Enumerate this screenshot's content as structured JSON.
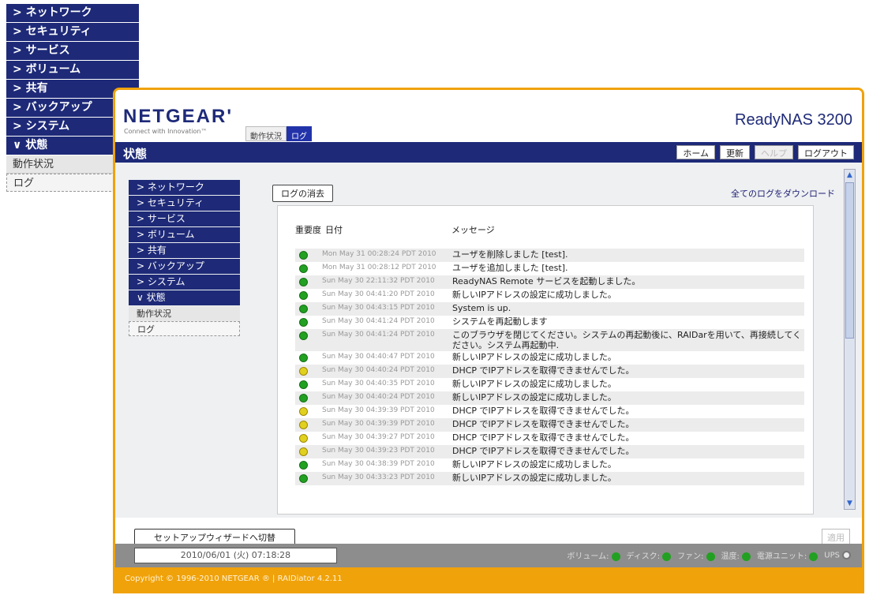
{
  "outer_nav": {
    "items": [
      "> ネットワーク",
      "> セキュリティ",
      "> サービス",
      "> ボリューム",
      "> 共有",
      "> バックアップ",
      "> システム",
      "∨ 状態"
    ],
    "subitems": [
      "動作状況",
      "ログ"
    ]
  },
  "header": {
    "logo": "NETGEAR'",
    "tagline": "Connect with Innovation™",
    "product": "ReadyNAS 3200",
    "tabs": [
      "動作状況",
      "ログ"
    ]
  },
  "titlebar": {
    "title": "状態",
    "buttons": [
      "ホーム",
      "更新",
      "ヘルプ",
      "ログアウト"
    ]
  },
  "inner_nav": {
    "items": [
      "> ネットワーク",
      "> セキュリティ",
      "> サービス",
      "> ボリューム",
      "> 共有",
      "> バックアップ",
      "> システム",
      "∨ 状態"
    ],
    "subitems": [
      "動作状況",
      "ログ"
    ]
  },
  "log": {
    "clear_button": "ログの消去",
    "download_link": "全てのログをダウンロード",
    "col_severity": "重要度",
    "col_date": "日付",
    "col_message": "メッセージ",
    "rows": [
      {
        "level": "ok",
        "date": "Mon May 31 00:28:24 PDT 2010",
        "message": "ユーザを削除しました [test]."
      },
      {
        "level": "ok",
        "date": "Mon May 31 00:28:12 PDT 2010",
        "message": "ユーザを追加しました [test]."
      },
      {
        "level": "ok",
        "date": "Sun May 30 22:11:32 PDT 2010",
        "message": "ReadyNAS Remote サービスを起動しました。"
      },
      {
        "level": "ok",
        "date": "Sun May 30 04:41:20 PDT 2010",
        "message": "新しいIPアドレスの設定に成功しました。"
      },
      {
        "level": "ok",
        "date": "Sun May 30 04:43:15 PDT 2010",
        "message": "System is up."
      },
      {
        "level": "ok",
        "date": "Sun May 30 04:41:24 PDT 2010",
        "message": "システムを再起動します"
      },
      {
        "level": "ok",
        "date": "Sun May 30 04:41:24 PDT 2010",
        "message": "このブラウザを閉じてください。システムの再起動後に、RAIDarを用いて、再接続してください。システム再起動中."
      },
      {
        "level": "ok",
        "date": "Sun May 30 04:40:47 PDT 2010",
        "message": "新しいIPアドレスの設定に成功しました。"
      },
      {
        "level": "warn",
        "date": "Sun May 30 04:40:24 PDT 2010",
        "message": "DHCP でIPアドレスを取得できませんでした。"
      },
      {
        "level": "ok",
        "date": "Sun May 30 04:40:35 PDT 2010",
        "message": "新しいIPアドレスの設定に成功しました。"
      },
      {
        "level": "ok",
        "date": "Sun May 30 04:40:24 PDT 2010",
        "message": "新しいIPアドレスの設定に成功しました。"
      },
      {
        "level": "warn",
        "date": "Sun May 30 04:39:39 PDT 2010",
        "message": "DHCP でIPアドレスを取得できませんでした。"
      },
      {
        "level": "warn",
        "date": "Sun May 30 04:39:39 PDT 2010",
        "message": "DHCP でIPアドレスを取得できませんでした。"
      },
      {
        "level": "warn",
        "date": "Sun May 30 04:39:27 PDT 2010",
        "message": "DHCP でIPアドレスを取得できませんでした。"
      },
      {
        "level": "warn",
        "date": "Sun May 30 04:39:23 PDT 2010",
        "message": "DHCP でIPアドレスを取得できませんでした。"
      },
      {
        "level": "ok",
        "date": "Sun May 30 04:38:39 PDT 2010",
        "message": "新しいIPアドレスの設定に成功しました。"
      },
      {
        "level": "ok",
        "date": "Sun May 30 04:33:23 PDT 2010",
        "message": "新しいIPアドレスの設定に成功しました。"
      }
    ]
  },
  "footer": {
    "wizard_button": "セットアップウィザードへ切替",
    "apply_button": "適用",
    "clock": "2010/06/01 (火) 07:18:28",
    "indicators": [
      {
        "label": "ボリューム:",
        "state": "ok"
      },
      {
        "label": "ディスク:",
        "state": "ok"
      },
      {
        "label": "ファン:",
        "state": "ok"
      },
      {
        "label": "温度:",
        "state": "ok"
      },
      {
        "label": "電源ユニット:",
        "state": "ok"
      },
      {
        "label": "UPS",
        "state": "off"
      }
    ],
    "copyright": "Copyright © 1996-2010 NETGEAR ® | RAIDiator 4.2.11"
  },
  "colors": {
    "nav": "#1e2a78",
    "accent": "#f0a20a",
    "ok": "#22a022",
    "warn": "#e0d020"
  }
}
